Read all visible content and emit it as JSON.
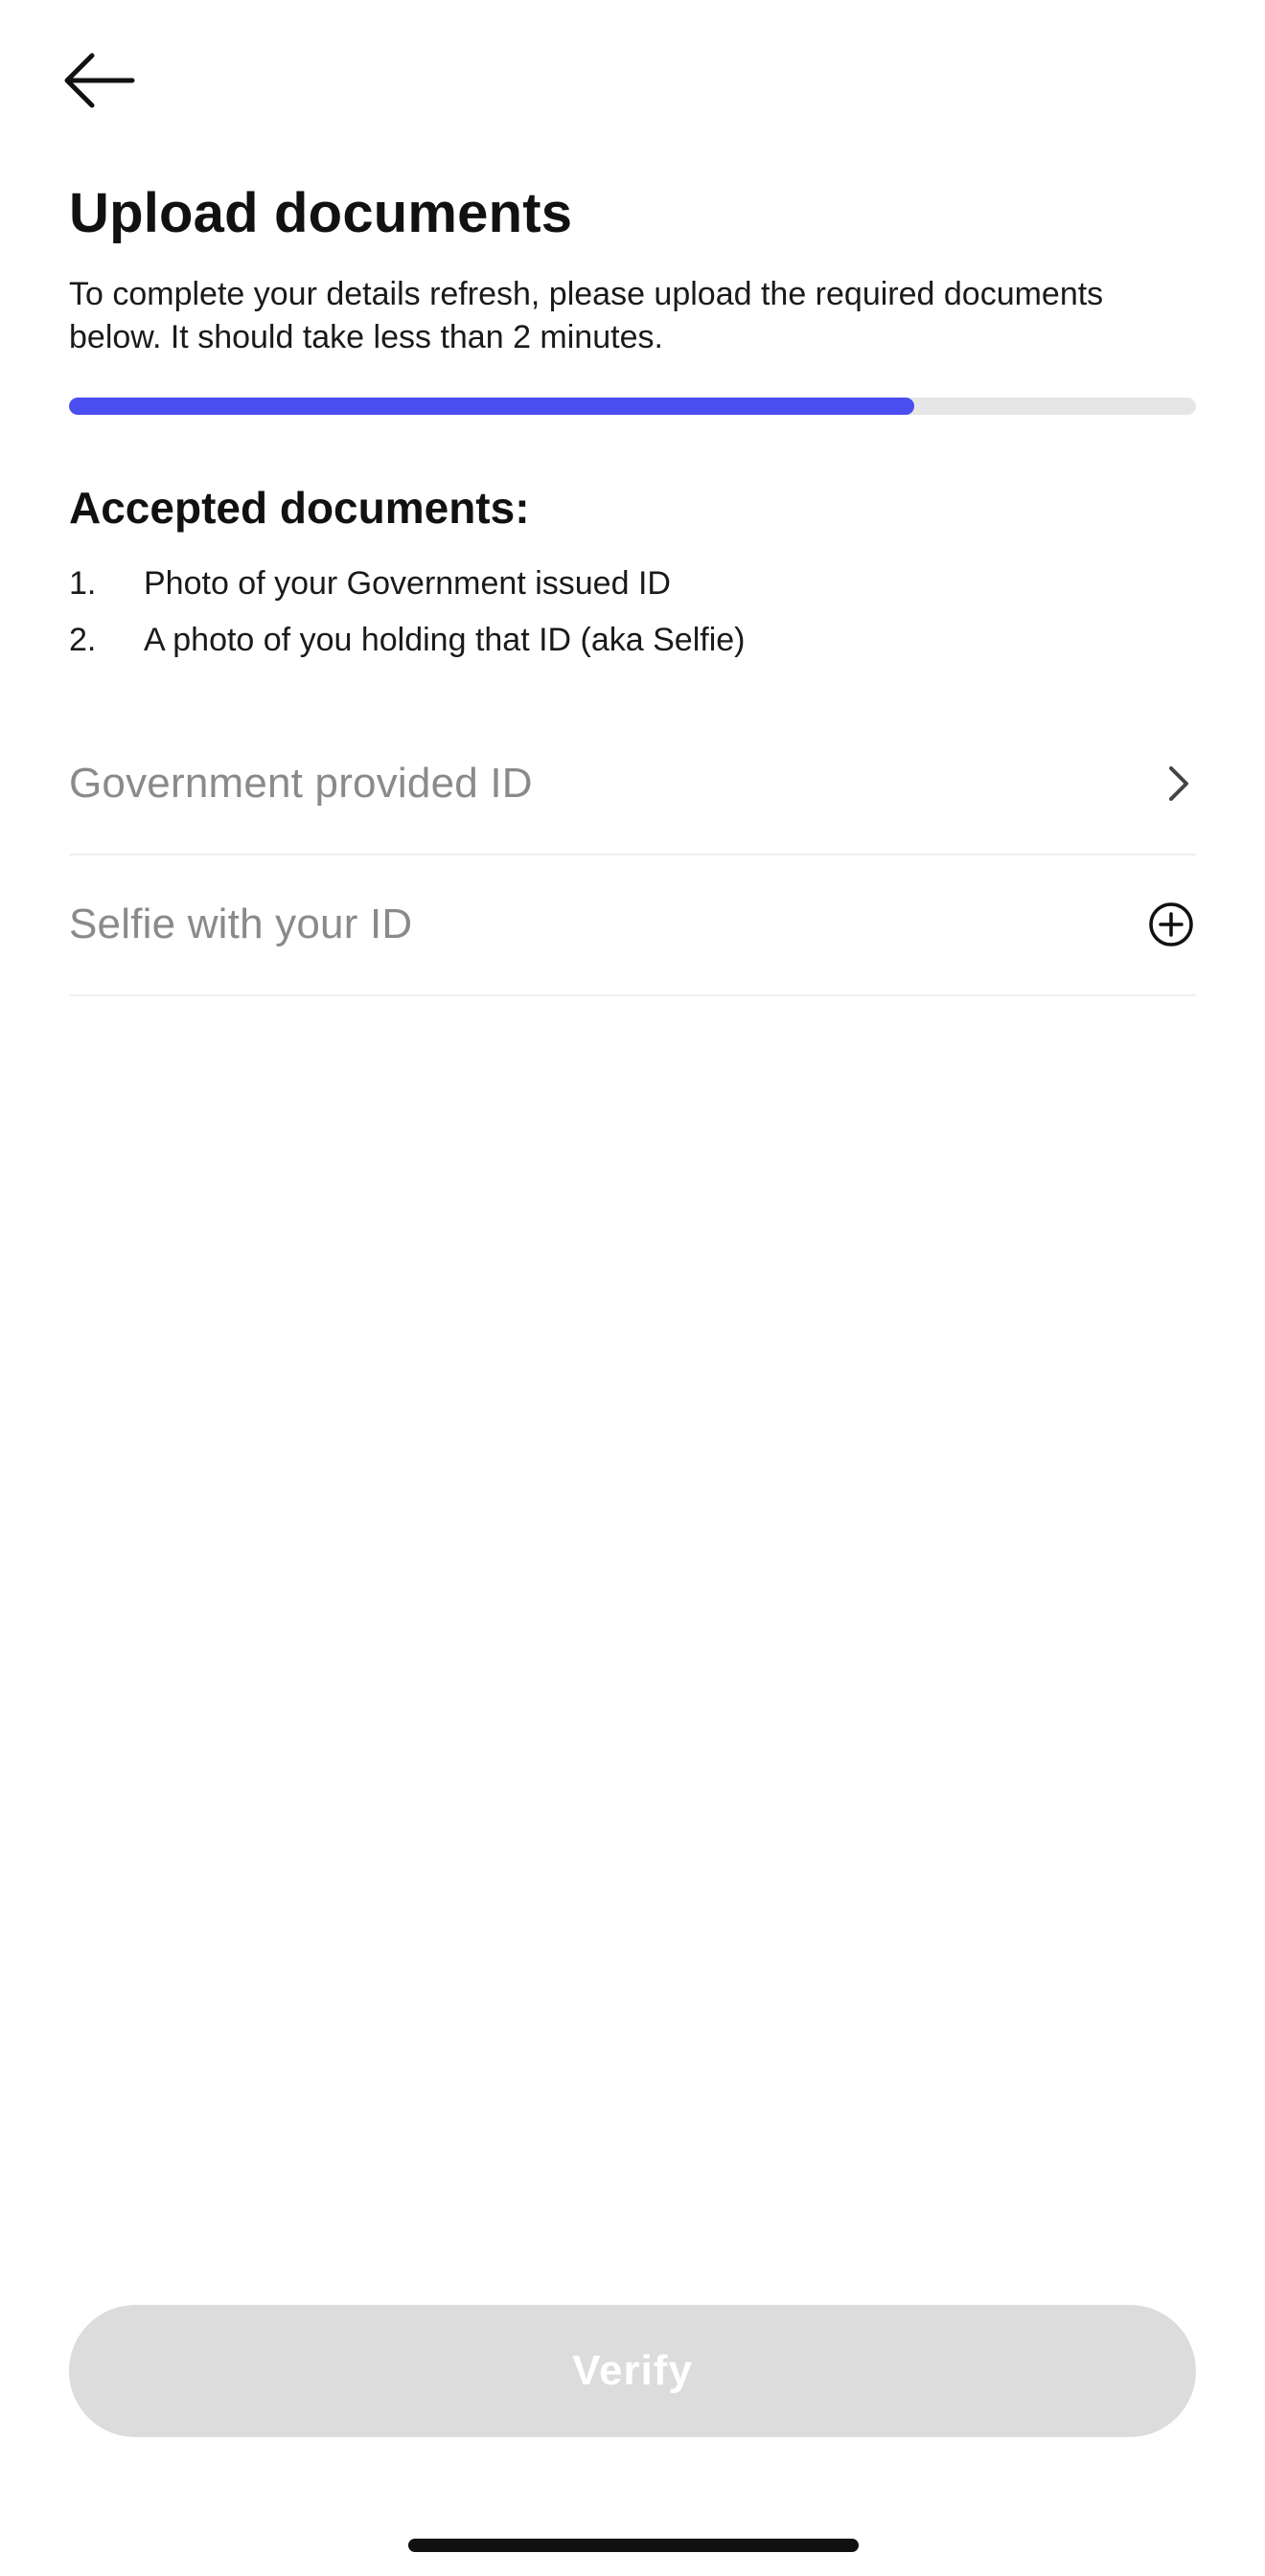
{
  "header": {
    "back_icon": "arrow-left-icon"
  },
  "page": {
    "title": "Upload documents",
    "subtitle": "To complete your details refresh, please upload the required documents below. It should take less than 2 minutes."
  },
  "progress": {
    "fraction": 0.75,
    "fill_color": "#4a4df0",
    "track_color": "#e6e6e6"
  },
  "accepted": {
    "heading": "Accepted documents:",
    "items": [
      {
        "number": "1.",
        "text": "Photo of your Government issued ID"
      },
      {
        "number": "2.",
        "text": "A photo of you holding that ID (aka Selfie)"
      }
    ]
  },
  "uploads": [
    {
      "label": "Government provided ID",
      "icon": "chevron-right-icon"
    },
    {
      "label": "Selfie with your ID",
      "icon": "plus-circle-icon"
    }
  ],
  "footer": {
    "verify_label": "Verify",
    "verify_enabled": false
  }
}
